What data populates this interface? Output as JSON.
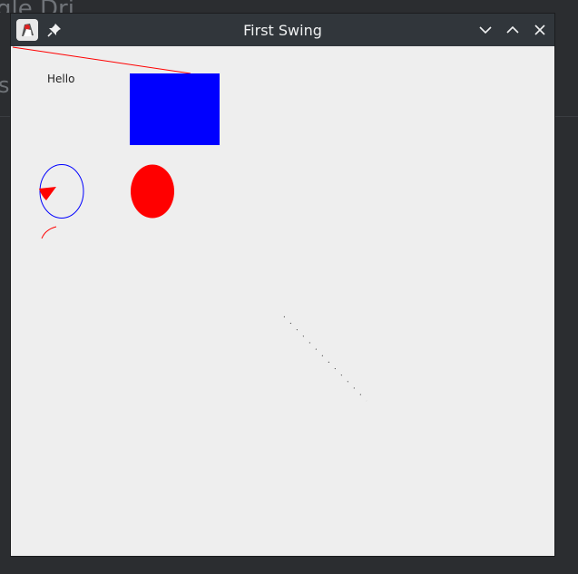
{
  "window": {
    "title": "First Swing",
    "app_icon": "java-duke-icon",
    "pin_icon": "pin-icon",
    "controls": [
      "minimize-icon",
      "maximize-icon",
      "close-icon"
    ]
  },
  "canvas": {
    "hello_text": "Hello",
    "colors": {
      "line": "#ff0000",
      "filled_rect": "#0000ff",
      "oval_outline": "#0000ff",
      "filled_oval": "#ff0000",
      "arc": "#ff0000",
      "dotted_line": "#333333"
    }
  },
  "background": {
    "text_top": "gle Dri",
    "text_mid": "s"
  }
}
